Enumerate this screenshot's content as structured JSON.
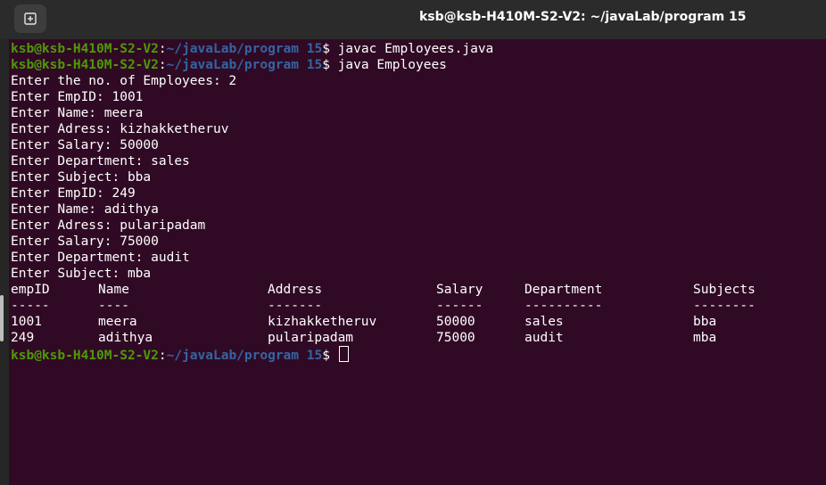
{
  "window": {
    "title": "ksb@ksb-H410M-S2-V2: ~/javaLab/program 15"
  },
  "prompt": {
    "user_host": "ksb@ksb-H410M-S2-V2",
    "sep": ":",
    "path": "~/javaLab/program 15",
    "symbol": "$ "
  },
  "commands": {
    "compile": "javac Employees.java",
    "run": "java Employees"
  },
  "output_lines": [
    "Enter the no. of Employees: 2",
    "Enter EmpID: 1001",
    "Enter Name: meera",
    "Enter Adress: kizhakketheruv",
    "Enter Salary: 50000",
    "Enter Department: sales",
    "Enter Subject: bba",
    "Enter EmpID: 249",
    "Enter Name: adithya",
    "Enter Adress: pularipadam",
    "Enter Salary: 75000",
    "Enter Department: audit",
    "Enter Subject: mba"
  ],
  "table": {
    "headers": [
      "empID",
      "Name",
      "Address",
      "Salary",
      "Department",
      "Subjects"
    ],
    "separators": [
      "-----",
      "----",
      "-------",
      "------",
      "----------",
      "--------"
    ],
    "rows": [
      [
        "1001",
        "meera",
        "kizhakketheruv",
        "50000",
        "sales",
        "bba"
      ],
      [
        "249",
        "adithya",
        "pularipadam",
        "75000",
        "audit",
        "mba"
      ]
    ]
  },
  "colors": {
    "terminal_bg": "#300a24",
    "prompt_user": "#4e9a06",
    "prompt_path": "#3465a4",
    "titlebar_bg": "#2b2b2b"
  },
  "icons": {
    "new_tab": "new-tab-icon"
  }
}
